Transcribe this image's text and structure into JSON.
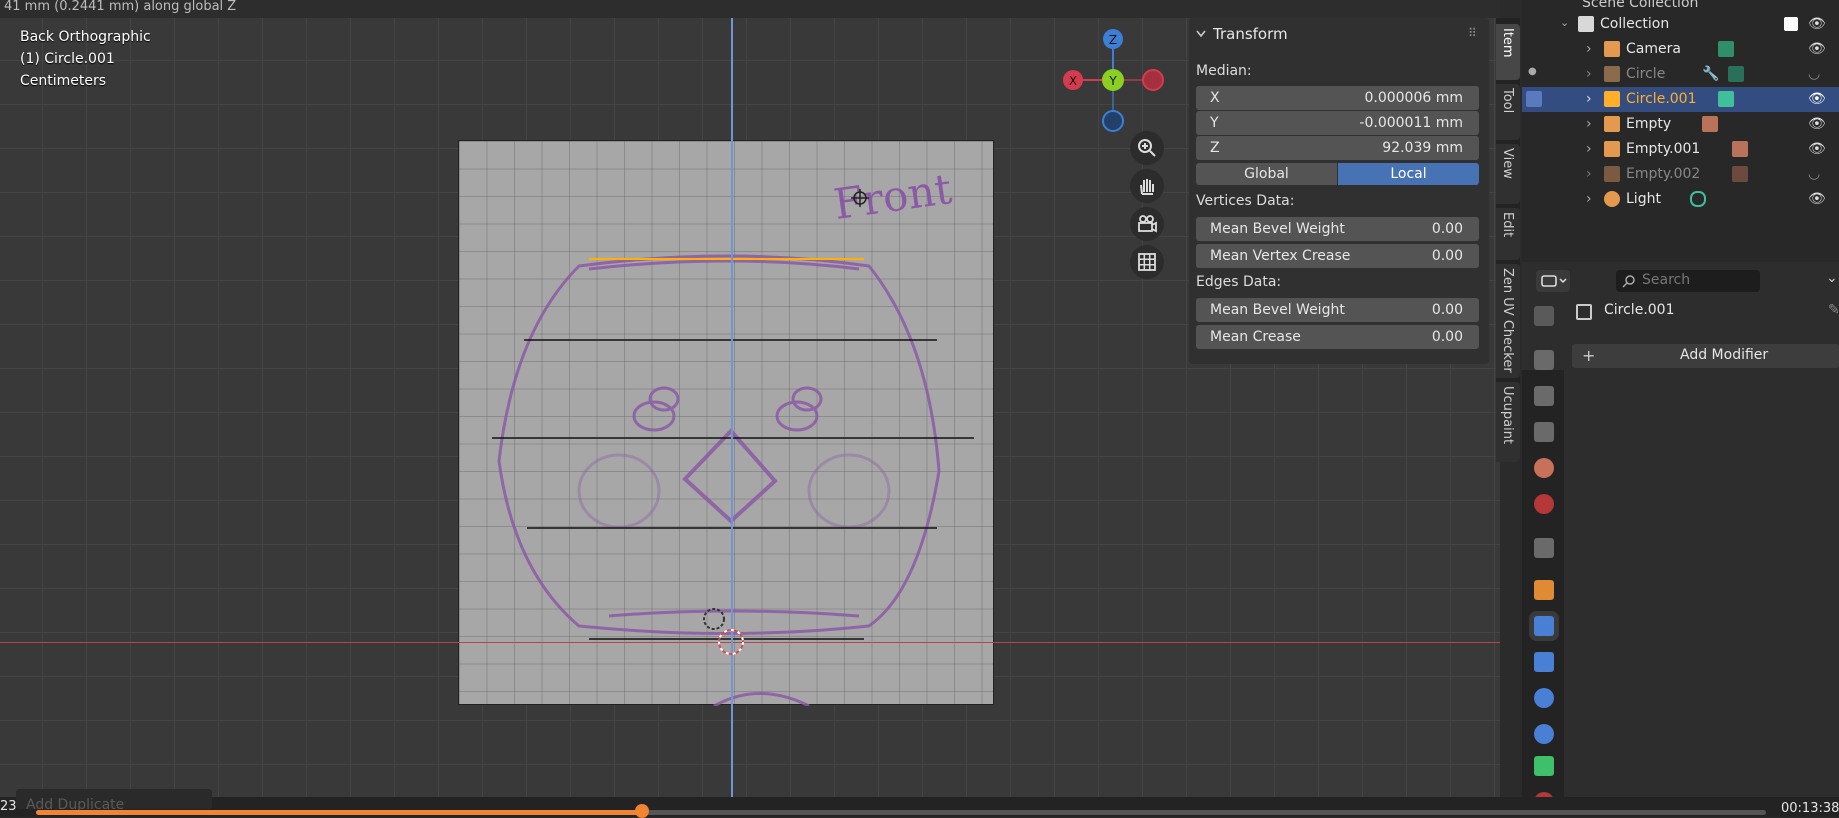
{
  "viewport": {
    "top_clipped_text": "41 mm (0.2441 mm) along global Z",
    "view_name": "Back Orthographic",
    "object_label": "(1) Circle.001",
    "units": "Centimeters",
    "reference_text": "Front",
    "gizmo": {
      "z": "Z",
      "y": "Y",
      "x": "X"
    }
  },
  "transform_panel": {
    "title": "Transform",
    "median_label": "Median:",
    "fields": [
      {
        "label": "X",
        "value": "0.000006 mm"
      },
      {
        "label": "Y",
        "value": "-0.000011 mm"
      },
      {
        "label": "Z",
        "value": "92.039 mm"
      }
    ],
    "toggle": {
      "global": "Global",
      "local": "Local",
      "active": "local"
    },
    "vertices_label": "Vertices Data:",
    "vertices": [
      {
        "label": "Mean Bevel Weight",
        "value": "0.00"
      },
      {
        "label": "Mean Vertex Crease",
        "value": "0.00"
      }
    ],
    "edges_label": "Edges Data:",
    "edges": [
      {
        "label": "Mean Bevel Weight",
        "value": "0.00"
      },
      {
        "label": "Mean Crease",
        "value": "0.00"
      }
    ]
  },
  "side_tabs": [
    "Item",
    "Tool",
    "View",
    "Edit",
    "Zen UV Checker",
    "Ucupaint"
  ],
  "outliner": {
    "scene_collection": "Scene Collection",
    "collection": "Collection",
    "items": [
      {
        "name": "Camera",
        "type": "camera"
      },
      {
        "name": "Circle",
        "type": "mesh"
      },
      {
        "name": "Circle.001",
        "type": "mesh"
      },
      {
        "name": "Empty",
        "type": "empty"
      },
      {
        "name": "Empty.001",
        "type": "empty"
      },
      {
        "name": "Empty.002",
        "type": "empty"
      },
      {
        "name": "Light",
        "type": "light"
      }
    ],
    "selected": "Circle.001"
  },
  "properties": {
    "search_placeholder": "Search",
    "object_name": "Circle.001",
    "add_modifier": "Add Modifier"
  },
  "timeline": {
    "frame": "23",
    "last_op": "Add Duplicate",
    "time": "00:13:38",
    "progress": 0.35
  },
  "colors": {
    "accent": "#4772b3",
    "selected_text": "#ffaf29",
    "playhead": "#f08432"
  }
}
